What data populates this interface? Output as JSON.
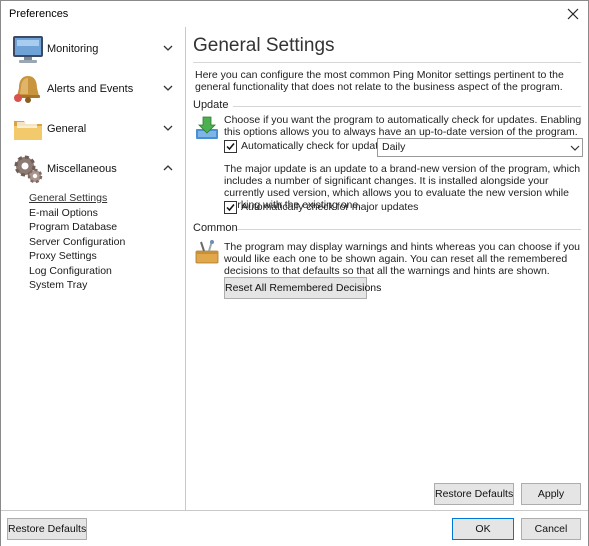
{
  "window": {
    "title": "Preferences"
  },
  "sidebar": {
    "sections": [
      {
        "label": "Monitoring",
        "icon": "monitor-icon",
        "expanded": false
      },
      {
        "label": "Alerts and Events",
        "icon": "bell-icon",
        "expanded": false
      },
      {
        "label": "General",
        "icon": "folder-icon",
        "expanded": false
      },
      {
        "label": "Miscellaneous",
        "icon": "gear-icon",
        "expanded": true
      }
    ],
    "items": [
      {
        "label": "General Settings",
        "active": true
      },
      {
        "label": "E-mail Options"
      },
      {
        "label": "Program Database"
      },
      {
        "label": "Server Configuration"
      },
      {
        "label": "Proxy Settings"
      },
      {
        "label": "Log Configuration"
      },
      {
        "label": "System Tray"
      }
    ]
  },
  "main": {
    "title": "General Settings",
    "intro": "Here you can configure the most common Ping Monitor settings pertinent to the general functionality that does not relate to the business aspect of the program.",
    "update": {
      "label": "Update",
      "description": "Choose if you want the program to automatically check for updates. Enabling this options allows you to always have an up-to-date version of the program.",
      "auto_check_label": "Automatically check for updates:",
      "auto_check_checked": true,
      "frequency": "Daily",
      "major_description": "The major update is an update to a brand-new version of the program, which includes a number of significant changes. It is installed alongside your currently used version, which allows you to evaluate the new version while working with the existing one.",
      "major_check_label": "Automatically check for major updates",
      "major_check_checked": true
    },
    "common": {
      "label": "Common",
      "description": "The program may display warnings and hints whereas you can choose if you would like each one to be shown again. You can reset all the remembered decisions to that defaults so that all the warnings and hints are shown.",
      "reset_button": "Reset All Remembered Decisions"
    },
    "restore_defaults": "Restore Defaults",
    "apply": "Apply"
  },
  "footer": {
    "restore_defaults": "Restore Defaults",
    "ok": "OK",
    "cancel": "Cancel"
  },
  "colors": {
    "accent": "#0078d7",
    "button_bg": "#e5e5e5"
  }
}
